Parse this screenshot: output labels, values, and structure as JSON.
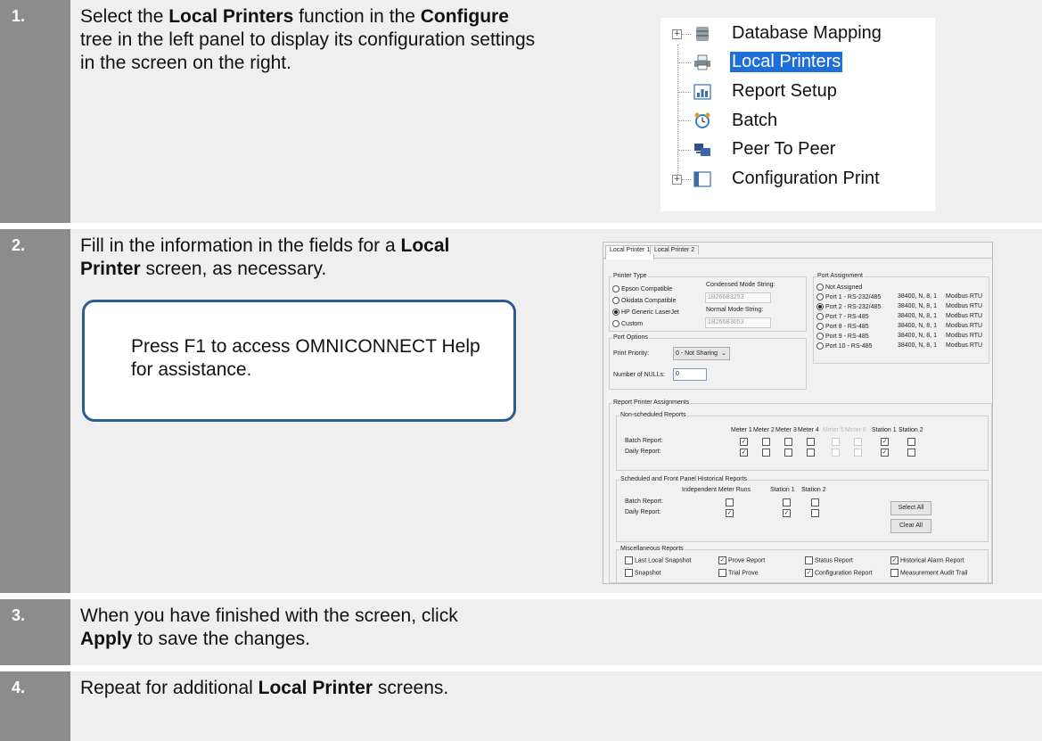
{
  "steps": [
    {
      "number": "1.",
      "pre": "Select the ",
      "b1": "Local Printers",
      "mid1": " function in the ",
      "b2": "Configure",
      "post": " tree in the left panel to display its configuration settings in the screen on the right."
    },
    {
      "number": "2.",
      "pre": "Fill in the information in the fields for a ",
      "b1": "Local Printer",
      "post": " screen, as necessary."
    },
    {
      "number": "3.",
      "pre": "When you have finished with the screen, click ",
      "b1": "Apply",
      "post": " to save the changes."
    },
    {
      "number": "4.",
      "pre": "Repeat for additional ",
      "b1": "Local Printer",
      "post": " screens."
    }
  ],
  "callout": "Press F1 to access OMNICONNECT Help for assistance.",
  "tree": {
    "items": [
      "Database Mapping",
      "Local Printers",
      "Report Setup",
      "Batch",
      "Peer To Peer",
      "Configuration Print"
    ],
    "selected": "Local Printers"
  },
  "screen": {
    "tabs": [
      "Local Printer 1",
      "Local Printer 2"
    ],
    "printer_type": {
      "title": "Printer Type",
      "options": [
        "Epson Compatible",
        "Okidata Compatible",
        "HP Generic LaserJet",
        "Custom"
      ],
      "selected": "HP Generic LaserJet",
      "condensed_label": "Condensed Mode String:",
      "condensed_value": "1B266B3253",
      "normal_label": "Normal Mode String:",
      "normal_value": "1B266B3053"
    },
    "port_assignment": {
      "title": "Port Assignment",
      "options": [
        {
          "label": "Not Assigned",
          "settings": "",
          "protocol": ""
        },
        {
          "label": "Port 1 - RS-232/485",
          "settings": "38400, N, 8, 1",
          "protocol": "Modbus RTU"
        },
        {
          "label": "Port 2 - RS-232/485",
          "settings": "38400, N, 8, 1",
          "protocol": "Modbus RTU"
        },
        {
          "label": "Port 7 - RS-485",
          "settings": "38400, N, 8, 1",
          "protocol": "Modbus RTU"
        },
        {
          "label": "Port 8 - RS-485",
          "settings": "38400, N, 8, 1",
          "protocol": "Modbus RTU"
        },
        {
          "label": "Port 9 - RS-485",
          "settings": "38400, N, 8, 1",
          "protocol": "Modbus RTU"
        },
        {
          "label": "Port 10 - RS-485",
          "settings": "38400, N, 8, 1",
          "protocol": "Modbus RTU"
        }
      ],
      "selected": "Port 2 - RS-232/485"
    },
    "port_options": {
      "title": "Port Options",
      "priority_label": "Print Priority:",
      "priority_value": "0 - Not Sharing",
      "nulls_label": "Number of NULLs:",
      "nulls_value": "0"
    },
    "report_assign": {
      "title": "Report Printer Assignments",
      "non_sched": {
        "title": "Non-scheduled Reports",
        "columns": [
          "Meter 1",
          "Meter 2",
          "Meter 3",
          "Meter 4",
          "Meter 5",
          "Meter 6",
          "Station 1",
          "Station 2"
        ],
        "rows": [
          {
            "label": "Batch Report:",
            "checks": [
              1,
              0,
              0,
              0,
              0,
              0,
              1,
              0
            ]
          },
          {
            "label": "Daily Report:",
            "checks": [
              1,
              0,
              0,
              0,
              0,
              0,
              1,
              0
            ]
          }
        ]
      },
      "sched": {
        "title": "Scheduled and Front Panel Historical Reports",
        "columns": [
          "Independent Meter Runs",
          "Station 1",
          "Station 2"
        ],
        "rows": [
          {
            "label": "Batch Report:",
            "checks": [
              0,
              0,
              0
            ]
          },
          {
            "label": "Daily Report:",
            "checks": [
              1,
              1,
              0
            ]
          }
        ],
        "select_all": "Select All",
        "clear_all": "Clear All"
      },
      "misc": {
        "title": "Miscellaneous Reports",
        "items": [
          {
            "label": "Last Local Snapshot",
            "checked": false
          },
          {
            "label": "Prove Report",
            "checked": true
          },
          {
            "label": "Status Report",
            "checked": false
          },
          {
            "label": "Historical Alarm Report",
            "checked": true
          },
          {
            "label": "Snapshot",
            "checked": false
          },
          {
            "label": "Trial Prove",
            "checked": false
          },
          {
            "label": "Configuration Report",
            "checked": true
          },
          {
            "label": "Measurement Audit Trail",
            "checked": false
          }
        ]
      }
    }
  }
}
